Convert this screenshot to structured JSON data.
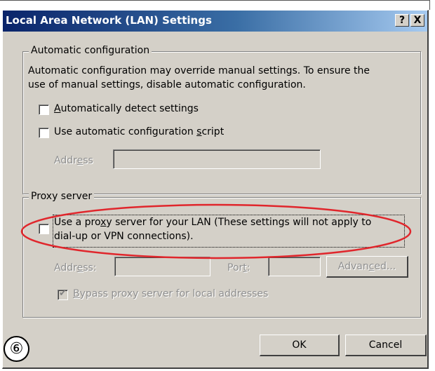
{
  "window": {
    "title": "Local Area Network (LAN) Settings",
    "help_button": "?",
    "close_button": "X"
  },
  "auto_config": {
    "legend": "Automatic configuration",
    "description_line1": "Automatic configuration may override manual settings.  To ensure the",
    "description_line2": "use of manual settings, disable automatic configuration.",
    "detect": {
      "label": "Automatically detect settings",
      "checked": false
    },
    "script": {
      "label": "Use automatic configuration script",
      "checked": false
    },
    "address_label": "Address",
    "address_value": ""
  },
  "proxy": {
    "legend": "Proxy server",
    "use_proxy": {
      "label_line1": "Use a proxy server for your LAN (These settings will not apply to",
      "label_line2": "dial-up or VPN connections).",
      "checked": false
    },
    "address_label": "Address:",
    "address_value": "",
    "port_label": "Port:",
    "port_value": "",
    "advanced_label": "Advanced...",
    "bypass": {
      "label": "Bypass proxy server for local addresses",
      "checked": true
    }
  },
  "footer": {
    "ok_label": "OK",
    "cancel_label": "Cancel"
  },
  "annotation": {
    "step_number": "⑥",
    "highlight_color": "#e0262c"
  }
}
